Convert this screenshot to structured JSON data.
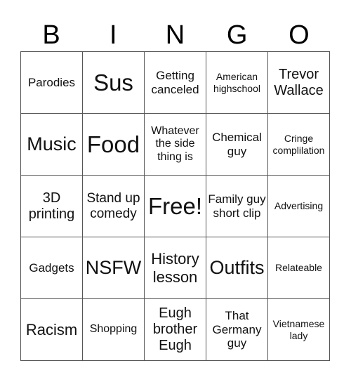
{
  "header": [
    "B",
    "I",
    "N",
    "G",
    "O"
  ],
  "cells": [
    {
      "text": "Parodies",
      "size": "s17"
    },
    {
      "text": "Sus",
      "size": "s32"
    },
    {
      "text": "Getting canceled",
      "size": "s17"
    },
    {
      "text": "American highschool",
      "size": "s14"
    },
    {
      "text": "Trevor Wallace",
      "size": "s20"
    },
    {
      "text": "Music",
      "size": "s26"
    },
    {
      "text": "Food",
      "size": "s32"
    },
    {
      "text": "Whatever the side thing is",
      "size": "s16"
    },
    {
      "text": "Chemical guy",
      "size": "s17"
    },
    {
      "text": "Cringe complilation",
      "size": "s14"
    },
    {
      "text": "3D printing",
      "size": "s20"
    },
    {
      "text": "Stand up comedy",
      "size": "s19"
    },
    {
      "text": "Free!",
      "size": "s32"
    },
    {
      "text": "Family guy short clip",
      "size": "s17"
    },
    {
      "text": "Advertising",
      "size": "s14"
    },
    {
      "text": "Gadgets",
      "size": "s17"
    },
    {
      "text": "NSFW",
      "size": "s26"
    },
    {
      "text": "History lesson",
      "size": "s22"
    },
    {
      "text": "Outfits",
      "size": "s26"
    },
    {
      "text": "Relateable",
      "size": "s14"
    },
    {
      "text": "Racism",
      "size": "s22"
    },
    {
      "text": "Shopping",
      "size": "s16"
    },
    {
      "text": "Eugh brother Eugh",
      "size": "s20"
    },
    {
      "text": "That Germany guy",
      "size": "s17"
    },
    {
      "text": "Vietnamese lady",
      "size": "s14"
    }
  ]
}
